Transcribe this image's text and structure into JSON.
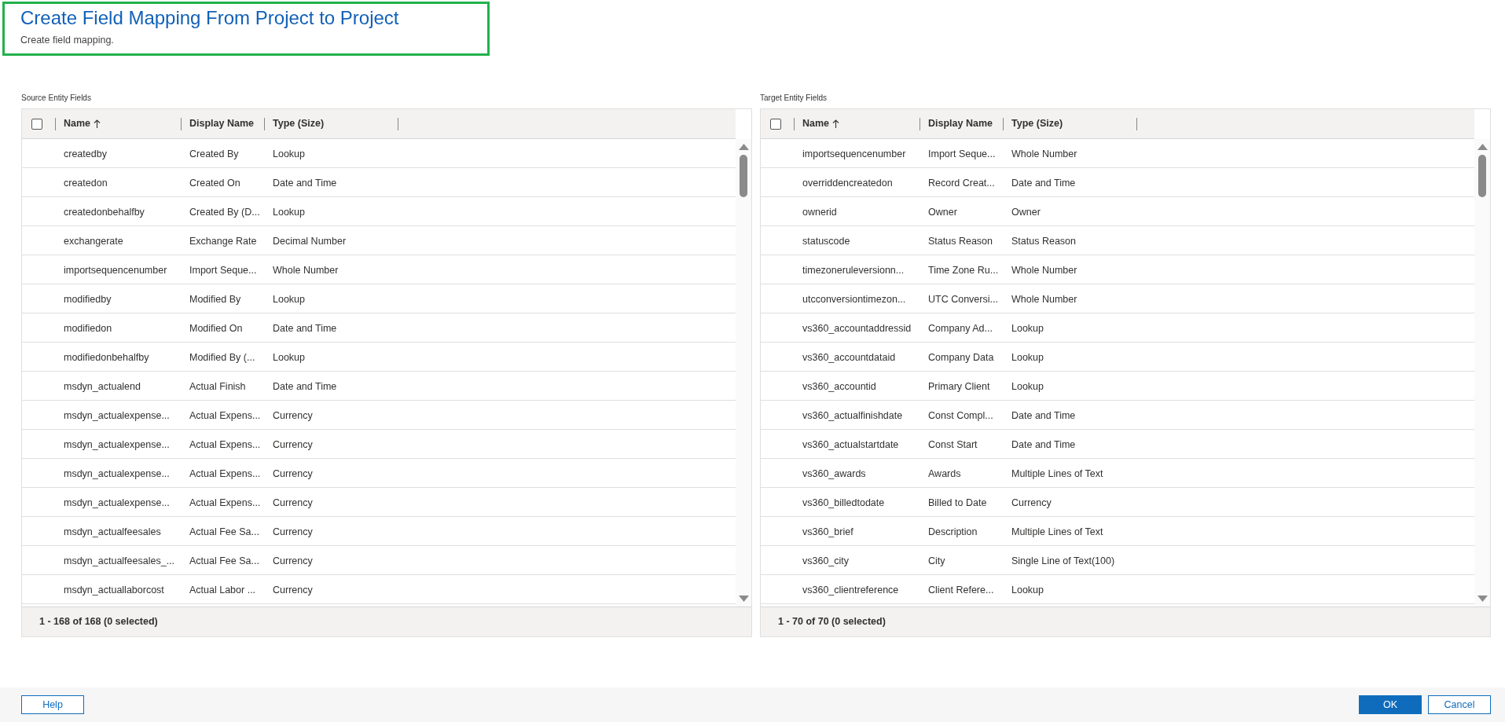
{
  "header": {
    "title": "Create Field Mapping From Project to Project",
    "subtitle": "Create field mapping."
  },
  "panels": [
    {
      "label": "Source Entity Fields",
      "select_all": {
        "checked": false
      },
      "columns": [
        {
          "label": "Name",
          "sorted": true
        },
        {
          "label": "Display Name",
          "sorted": false
        },
        {
          "label": "Type (Size)",
          "sorted": false
        }
      ],
      "rows": [
        {
          "name": "createdby",
          "display_name": "Created By",
          "type": "Lookup"
        },
        {
          "name": "createdon",
          "display_name": "Created On",
          "type": "Date and Time"
        },
        {
          "name": "createdonbehalfby",
          "display_name": "Created By (D...",
          "type": "Lookup"
        },
        {
          "name": "exchangerate",
          "display_name": "Exchange Rate",
          "type": "Decimal Number"
        },
        {
          "name": "importsequencenumber",
          "display_name": "Import Seque...",
          "type": "Whole Number"
        },
        {
          "name": "modifiedby",
          "display_name": "Modified By",
          "type": "Lookup"
        },
        {
          "name": "modifiedon",
          "display_name": "Modified On",
          "type": "Date and Time"
        },
        {
          "name": "modifiedonbehalfby",
          "display_name": "Modified By (...",
          "type": "Lookup"
        },
        {
          "name": "msdyn_actualend",
          "display_name": "Actual Finish",
          "type": "Date and Time"
        },
        {
          "name": "msdyn_actualexpense...",
          "display_name": "Actual Expens...",
          "type": "Currency"
        },
        {
          "name": "msdyn_actualexpense...",
          "display_name": "Actual Expens...",
          "type": "Currency"
        },
        {
          "name": "msdyn_actualexpense...",
          "display_name": "Actual Expens...",
          "type": "Currency"
        },
        {
          "name": "msdyn_actualexpense...",
          "display_name": "Actual Expens...",
          "type": "Currency"
        },
        {
          "name": "msdyn_actualfeesales",
          "display_name": "Actual Fee Sa...",
          "type": "Currency"
        },
        {
          "name": "msdyn_actualfeesales_...",
          "display_name": "Actual Fee Sa...",
          "type": "Currency"
        },
        {
          "name": "msdyn_actuallaborcost",
          "display_name": "Actual Labor ...",
          "type": "Currency"
        }
      ],
      "footer": "1 - 168 of 168 (0 selected)"
    },
    {
      "label": "Target Entity Fields",
      "select_all": {
        "checked": false
      },
      "columns": [
        {
          "label": "Name",
          "sorted": true
        },
        {
          "label": "Display Name",
          "sorted": false
        },
        {
          "label": "Type (Size)",
          "sorted": false
        }
      ],
      "rows": [
        {
          "name": "importsequencenumber",
          "display_name": "Import Seque...",
          "type": "Whole Number"
        },
        {
          "name": "overriddencreatedon",
          "display_name": "Record Creat...",
          "type": "Date and Time"
        },
        {
          "name": "ownerid",
          "display_name": "Owner",
          "type": "Owner"
        },
        {
          "name": "statuscode",
          "display_name": "Status Reason",
          "type": "Status Reason"
        },
        {
          "name": "timezoneruleversionn...",
          "display_name": "Time Zone Ru...",
          "type": "Whole Number"
        },
        {
          "name": "utcconversiontimezon...",
          "display_name": "UTC Conversi...",
          "type": "Whole Number"
        },
        {
          "name": "vs360_accountaddressid",
          "display_name": "Company Ad...",
          "type": "Lookup"
        },
        {
          "name": "vs360_accountdataid",
          "display_name": "Company Data",
          "type": "Lookup"
        },
        {
          "name": "vs360_accountid",
          "display_name": "Primary Client",
          "type": "Lookup"
        },
        {
          "name": "vs360_actualfinishdate",
          "display_name": "Const Compl...",
          "type": "Date and Time"
        },
        {
          "name": "vs360_actualstartdate",
          "display_name": "Const Start",
          "type": "Date and Time"
        },
        {
          "name": "vs360_awards",
          "display_name": "Awards",
          "type": "Multiple Lines of Text"
        },
        {
          "name": "vs360_billedtodate",
          "display_name": "Billed to Date",
          "type": "Currency"
        },
        {
          "name": "vs360_brief",
          "display_name": "Description",
          "type": "Multiple Lines of Text"
        },
        {
          "name": "vs360_city",
          "display_name": "City",
          "type": "Single Line of Text(100)"
        },
        {
          "name": "vs360_clientreference",
          "display_name": "Client Refere...",
          "type": "Lookup"
        }
      ],
      "footer": "1 - 70 of 70 (0 selected)"
    }
  ],
  "left_buttons": [
    {
      "label": "Help",
      "kind": "outline"
    }
  ],
  "right_buttons": [
    {
      "label": "OK",
      "kind": "primary"
    },
    {
      "label": "Cancel",
      "kind": "outline"
    }
  ]
}
